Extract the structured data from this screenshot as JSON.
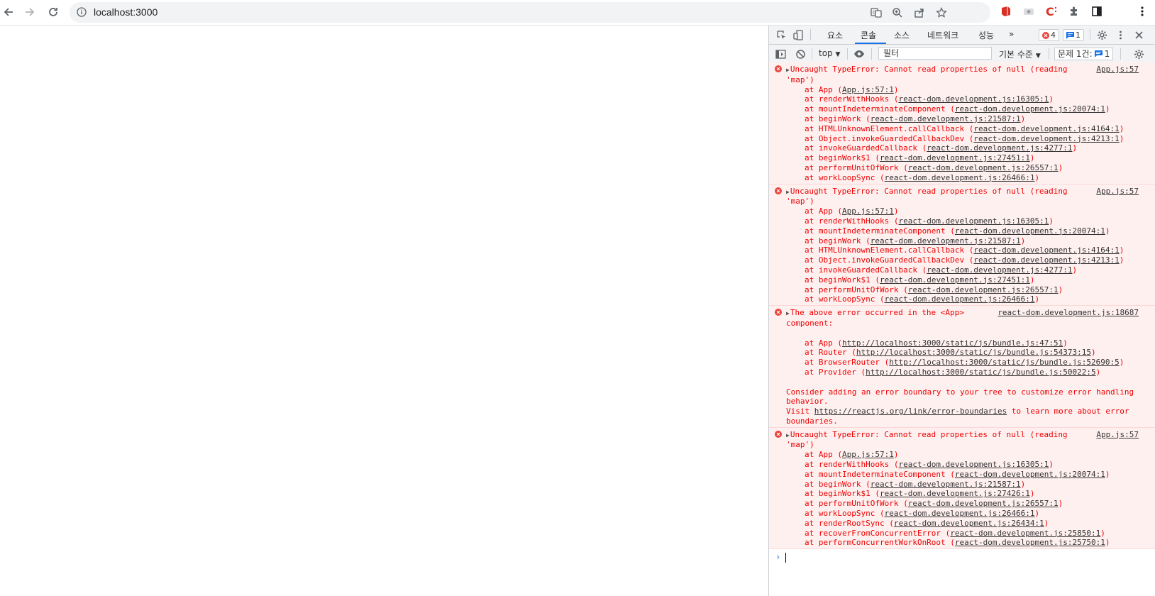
{
  "browser": {
    "url": "localhost:3000"
  },
  "devtools": {
    "tabs": [
      "요소",
      "콘솔",
      "소스",
      "네트워크",
      "성능"
    ],
    "active_tab": "콘솔",
    "more_tabs": "»",
    "error_count": "4",
    "message_count": "1",
    "toolbar": {
      "context": "top",
      "filter_placeholder": "필터",
      "levels": "기본 수준",
      "issues_label": "문제 1건:",
      "issues_count": "1"
    },
    "messages": [
      {
        "head1": "Uncaught TypeError: Cannot read properties of null (reading",
        "head2": "'map')",
        "source": "App.js:57",
        "stack": [
          {
            "fn": "at App (",
            "link": "App.js:57:1",
            "end": ")"
          },
          {
            "fn": "at renderWithHooks (",
            "link": "react-dom.development.js:16305:1",
            "end": ")"
          },
          {
            "fn": "at mountIndeterminateComponent (",
            "link": "react-dom.development.js:20074:1",
            "end": ")"
          },
          {
            "fn": "at beginWork (",
            "link": "react-dom.development.js:21587:1",
            "end": ")"
          },
          {
            "fn": "at HTMLUnknownElement.callCallback (",
            "link": "react-dom.development.js:4164:1",
            "end": ")"
          },
          {
            "fn": "at Object.invokeGuardedCallbackDev (",
            "link": "react-dom.development.js:4213:1",
            "end": ")"
          },
          {
            "fn": "at invokeGuardedCallback (",
            "link": "react-dom.development.js:4277:1",
            "end": ")"
          },
          {
            "fn": "at beginWork$1 (",
            "link": "react-dom.development.js:27451:1",
            "end": ")"
          },
          {
            "fn": "at performUnitOfWork (",
            "link": "react-dom.development.js:26557:1",
            "end": ")"
          },
          {
            "fn": "at workLoopSync (",
            "link": "react-dom.development.js:26466:1",
            "end": ")"
          }
        ]
      },
      {
        "head1": "Uncaught TypeError: Cannot read properties of null (reading",
        "head2": "'map')",
        "source": "App.js:57",
        "stack": [
          {
            "fn": "at App (",
            "link": "App.js:57:1",
            "end": ")"
          },
          {
            "fn": "at renderWithHooks (",
            "link": "react-dom.development.js:16305:1",
            "end": ")"
          },
          {
            "fn": "at mountIndeterminateComponent (",
            "link": "react-dom.development.js:20074:1",
            "end": ")"
          },
          {
            "fn": "at beginWork (",
            "link": "react-dom.development.js:21587:1",
            "end": ")"
          },
          {
            "fn": "at HTMLUnknownElement.callCallback (",
            "link": "react-dom.development.js:4164:1",
            "end": ")"
          },
          {
            "fn": "at Object.invokeGuardedCallbackDev (",
            "link": "react-dom.development.js:4213:1",
            "end": ")"
          },
          {
            "fn": "at invokeGuardedCallback (",
            "link": "react-dom.development.js:4277:1",
            "end": ")"
          },
          {
            "fn": "at beginWork$1 (",
            "link": "react-dom.development.js:27451:1",
            "end": ")"
          },
          {
            "fn": "at performUnitOfWork (",
            "link": "react-dom.development.js:26557:1",
            "end": ")"
          },
          {
            "fn": "at workLoopSync (",
            "link": "react-dom.development.js:26466:1",
            "end": ")"
          }
        ]
      },
      {
        "head1": "The above error occurred in the <App>",
        "head2": "component:",
        "source": "react-dom.development.js:18687",
        "stack": [
          {
            "fn": "at App (",
            "link": "http://localhost:3000/static/js/bundle.js:47:51",
            "end": ")"
          },
          {
            "fn": "at Router (",
            "link": "http://localhost:3000/static/js/bundle.js:54373:15",
            "end": ")"
          },
          {
            "fn": "at BrowserRouter (",
            "link": "http://localhost:3000/static/js/bundle.js:52690:5",
            "end": ")"
          },
          {
            "fn": "at Provider (",
            "link": "http://localhost:3000/static/js/bundle.js:50022:5",
            "end": ")"
          }
        ],
        "footer1": "Consider adding an error boundary to your tree to customize error handling",
        "footer2": "behavior.",
        "visit_pre": "Visit ",
        "visit_link": "https://reactjs.org/link/error-boundaries",
        "visit_post": " to learn more about error",
        "footer4": "boundaries."
      },
      {
        "head1": "Uncaught TypeError: Cannot read properties of null (reading",
        "head2": "'map')",
        "source": "App.js:57",
        "stack": [
          {
            "fn": "at App (",
            "link": "App.js:57:1",
            "end": ")"
          },
          {
            "fn": "at renderWithHooks (",
            "link": "react-dom.development.js:16305:1",
            "end": ")"
          },
          {
            "fn": "at mountIndeterminateComponent (",
            "link": "react-dom.development.js:20074:1",
            "end": ")"
          },
          {
            "fn": "at beginWork (",
            "link": "react-dom.development.js:21587:1",
            "end": ")"
          },
          {
            "fn": "at beginWork$1 (",
            "link": "react-dom.development.js:27426:1",
            "end": ")"
          },
          {
            "fn": "at performUnitOfWork (",
            "link": "react-dom.development.js:26557:1",
            "end": ")"
          },
          {
            "fn": "at workLoopSync (",
            "link": "react-dom.development.js:26466:1",
            "end": ")"
          },
          {
            "fn": "at renderRootSync (",
            "link": "react-dom.development.js:26434:1",
            "end": ")"
          },
          {
            "fn": "at recoverFromConcurrentError (",
            "link": "react-dom.development.js:25850:1",
            "end": ")"
          },
          {
            "fn": "at performConcurrentWorkOnRoot (",
            "link": "react-dom.development.js:25750:1",
            "end": ")"
          }
        ]
      }
    ],
    "prompt": "›"
  }
}
